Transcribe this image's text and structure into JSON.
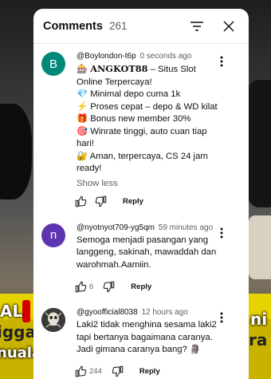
{
  "header": {
    "title": "Comments",
    "count": "261"
  },
  "comments": [
    {
      "author": "@Boylondon-t6p",
      "time": "0 seconds ago",
      "avatar_letter": "B",
      "avatar_color": "#00897b",
      "text_line1_icon": "🎰",
      "text_line1_brand": "ANGKOT88",
      "text_line1_rest": " – Situs Slot Online Terpercaya!",
      "text_rest": "💎 Minimal depo cuma 1k\n⚡ Proses cepat – depo & WD kilat\n🎁 Bonus new member 30%\n🎯 Winrate tinggi, auto cuan tiap hari!\n🔐 Aman, terpercaya, CS 24 jam ready!",
      "show_less": "Show less",
      "likes": "",
      "reply": "Reply"
    },
    {
      "author": "@nyotnyot709-yg5qm",
      "time": "59 minutes ago",
      "avatar_letter": "n",
      "avatar_color": "#5e35b1",
      "text": "Semoga menjadi pasangan yang langgeng, sakinah, mawaddah dan warohmah.Aamiin.",
      "likes": "6",
      "reply": "Reply"
    },
    {
      "author": "@gyoofficial8038",
      "time": "12 hours ago",
      "avatar_letter": "",
      "avatar_color": "#2b2b2b",
      "text": "Laki2 tidak menghina sesama laki2 tapi bertanya bagaimana caranya. Jadi gimana caranya bang? 🗿",
      "likes": "244",
      "reply": "Reply"
    }
  ],
  "icons": {
    "sort": "sort-icon",
    "close": "close-icon",
    "more": "more-vert-icon",
    "like": "thumb-up-icon",
    "dislike": "thumb-down-icon"
  },
  "background": {
    "left_text_1": "AL",
    "left_text_2": "igga",
    "left_text_3": "nuala",
    "right_text": "ni",
    "right_text_2": "ra"
  }
}
